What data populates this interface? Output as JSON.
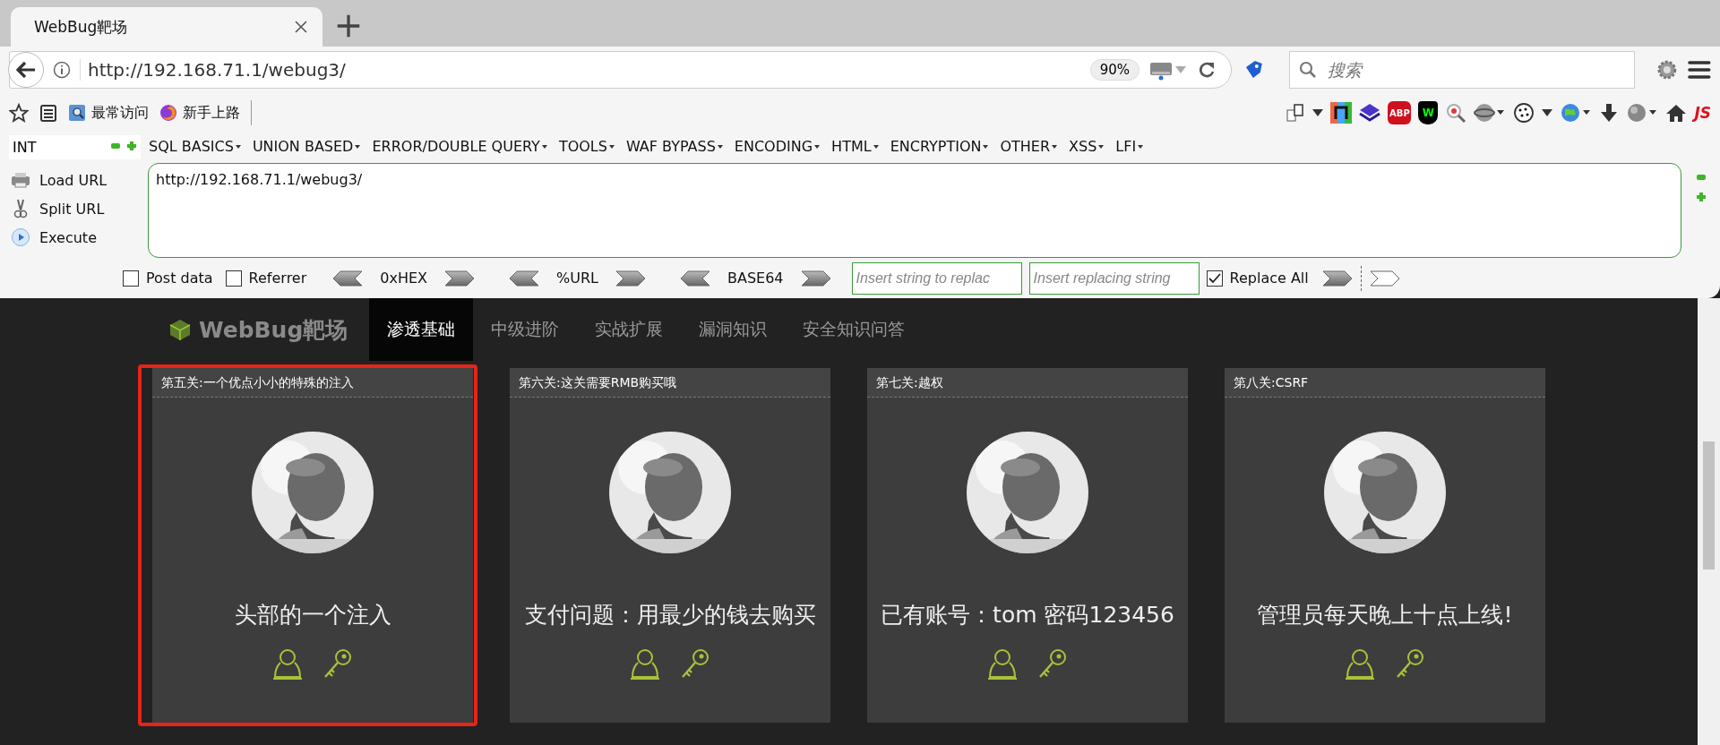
{
  "browser": {
    "tab": {
      "title": "WebBug靶场"
    },
    "url": "http://192.168.71.1/webug3/",
    "zoom": "90%",
    "search": {
      "placeholder": "搜索"
    },
    "bookmarks": [
      {
        "kind": "star"
      },
      {
        "kind": "list"
      },
      {
        "kind": "folder",
        "label": "最常访问"
      },
      {
        "kind": "firefox",
        "label": "新手上路"
      }
    ],
    "extensions": [
      {
        "kind": "pages"
      },
      {
        "kind": "caret"
      },
      {
        "kind": "rainbow"
      },
      {
        "kind": "layers"
      },
      {
        "kind": "badge",
        "text": "ABP"
      },
      {
        "kind": "shield",
        "text": "W"
      },
      {
        "kind": "magnifier"
      },
      {
        "kind": "globe"
      },
      {
        "kind": "cookie"
      },
      {
        "kind": "caret"
      },
      {
        "kind": "earth"
      },
      {
        "kind": "download"
      },
      {
        "kind": "world"
      },
      {
        "kind": "home"
      },
      {
        "kind": "script",
        "text": "JS"
      }
    ]
  },
  "hackbar": {
    "type_select": "INT",
    "menus": [
      "SQL BASICS",
      "UNION BASED",
      "ERROR/DOUBLE QUERY",
      "TOOLS",
      "WAF BYPASS",
      "ENCODING",
      "HTML",
      "ENCRYPTION",
      "OTHER",
      "XSS",
      "LFI"
    ],
    "actions": [
      {
        "kind": "load",
        "label": "Load URL"
      },
      {
        "kind": "split",
        "label": "Split URL"
      },
      {
        "kind": "execute",
        "label": "Execute"
      }
    ],
    "url_text": "http://192.168.71.1/webug3/",
    "options": [
      {
        "kind": "checkbox",
        "label": "Post data",
        "checked": false
      },
      {
        "kind": "checkbox",
        "label": "Referrer",
        "checked": false
      },
      {
        "kind": "codec",
        "label": "0xHEX"
      },
      {
        "kind": "codec",
        "label": "%URL"
      },
      {
        "kind": "codec",
        "label": "BASE64"
      },
      {
        "kind": "field",
        "placeholder": "Insert string to replac"
      },
      {
        "kind": "field",
        "placeholder": "Insert replacing string"
      },
      {
        "kind": "checkbox",
        "label": "Replace All",
        "checked": true
      },
      {
        "kind": "arrows"
      }
    ]
  },
  "site": {
    "logo": "WebBug靶场",
    "nav": [
      {
        "label": "渗透基础",
        "selected": true
      },
      {
        "label": "中级进阶",
        "selected": false
      },
      {
        "label": "实战扩展",
        "selected": false
      },
      {
        "label": "漏洞知识",
        "selected": false
      },
      {
        "label": "安全知识问答",
        "selected": false
      }
    ],
    "cards": [
      {
        "header": "第五关:一个优点小小的特殊的注入",
        "title": "头部的一个注入",
        "highlighted": true
      },
      {
        "header": "第六关:这关需要RMB购买哦",
        "title": "支付问题：用最少的钱去购买",
        "highlighted": false
      },
      {
        "header": "第七关:越权",
        "title": "已有账号：tom 密码123456",
        "highlighted": false
      },
      {
        "header": "第八关:CSRF",
        "title": "管理员每天晚上十点上线!",
        "highlighted": false
      }
    ]
  }
}
